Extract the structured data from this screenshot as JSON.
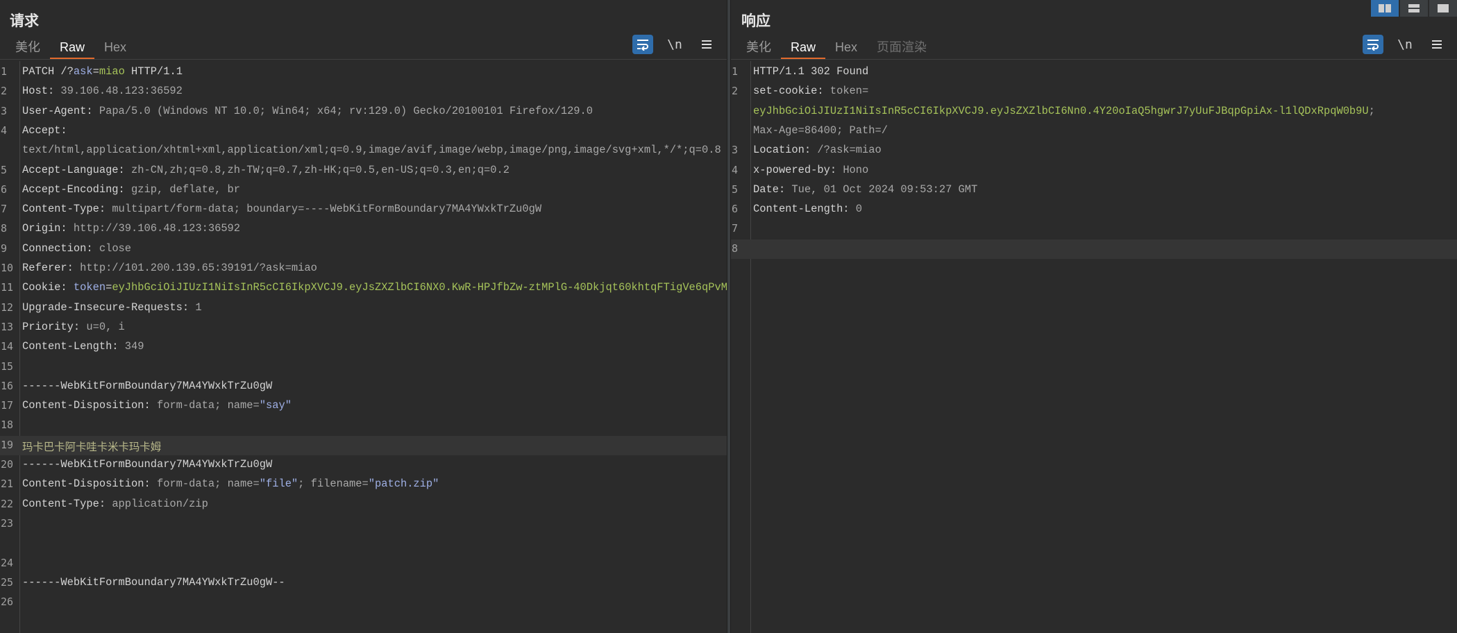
{
  "request": {
    "title": "请求",
    "tabs": [
      {
        "label": "美化",
        "state": "normal"
      },
      {
        "label": "Raw",
        "state": "active"
      },
      {
        "label": "Hex",
        "state": "normal"
      }
    ],
    "tools": {
      "wrap_icon": "wrap-lines-icon",
      "newline_label": "\\n",
      "menu_icon": "menu-icon"
    },
    "lines": [
      {
        "n": "1",
        "parts": [
          [
            "k",
            "PATCH /?"
          ],
          [
            "p",
            "ask"
          ],
          [
            "k",
            "="
          ],
          [
            "s",
            "miao"
          ],
          [
            "k",
            " HTTP/1.1"
          ]
        ]
      },
      {
        "n": "2",
        "parts": [
          [
            "k",
            "Host: "
          ],
          [
            "v",
            "39.106.48.123:36592"
          ]
        ]
      },
      {
        "n": "3",
        "parts": [
          [
            "k",
            "User-Agent: "
          ],
          [
            "v",
            "Papa/5.0 (Windows NT 10.0; Win64; x64; rv:129.0) Gecko/20100101 Firefox/129.0"
          ]
        ]
      },
      {
        "n": "4",
        "parts": [
          [
            "k",
            "Accept: "
          ]
        ]
      },
      {
        "n": "",
        "parts": [
          [
            "v",
            "text/html,application/xhtml+xml,application/xml;q=0.9,image/avif,image/webp,image/png,image/svg+xml,*/*;q=0.8"
          ]
        ]
      },
      {
        "n": "5",
        "parts": [
          [
            "k",
            "Accept-Language: "
          ],
          [
            "v",
            "zh-CN,zh;q=0.8,zh-TW;q=0.7,zh-HK;q=0.5,en-US;q=0.3,en;q=0.2"
          ]
        ]
      },
      {
        "n": "6",
        "parts": [
          [
            "k",
            "Accept-Encoding: "
          ],
          [
            "v",
            "gzip, deflate, br"
          ]
        ]
      },
      {
        "n": "7",
        "parts": [
          [
            "k",
            "Content-Type: "
          ],
          [
            "v",
            "multipart/form-data; boundary=----WebKitFormBoundary7MA4YWxkTrZu0gW"
          ]
        ]
      },
      {
        "n": "8",
        "parts": [
          [
            "k",
            "Origin: "
          ],
          [
            "v",
            "http://39.106.48.123:36592"
          ]
        ]
      },
      {
        "n": "9",
        "parts": [
          [
            "k",
            "Connection: "
          ],
          [
            "v",
            "close"
          ]
        ]
      },
      {
        "n": "10",
        "parts": [
          [
            "k",
            "Referer: "
          ],
          [
            "v",
            "http://101.200.139.65:39191/?ask=miao"
          ]
        ]
      },
      {
        "n": "11",
        "parts": [
          [
            "k",
            "Cookie: "
          ],
          [
            "p",
            "token"
          ],
          [
            "k",
            "="
          ],
          [
            "s",
            "eyJhbGciOiJIUzI1NiIsInR5cCI6IkpXVCJ9.eyJsZXZlbCI6NX0.KwR-HPJfbZw-ztMPlG-40Dkjqt60khtqFTigVe6qPvM"
          ]
        ]
      },
      {
        "n": "12",
        "parts": [
          [
            "k",
            "Upgrade-Insecure-Requests: "
          ],
          [
            "v",
            "1"
          ]
        ]
      },
      {
        "n": "13",
        "parts": [
          [
            "k",
            "Priority: "
          ],
          [
            "v",
            "u=0, i"
          ]
        ]
      },
      {
        "n": "14",
        "parts": [
          [
            "k",
            "Content-Length: "
          ],
          [
            "v",
            "349"
          ]
        ]
      },
      {
        "n": "15",
        "parts": []
      },
      {
        "n": "16",
        "parts": [
          [
            "k",
            "------WebKitFormBoundary7MA4YWxkTrZu0gW"
          ]
        ]
      },
      {
        "n": "17",
        "parts": [
          [
            "k",
            "Content-Disposition: "
          ],
          [
            "v",
            "form-data; name="
          ],
          [
            "p",
            "\"say\""
          ]
        ]
      },
      {
        "n": "18",
        "parts": []
      },
      {
        "n": "19",
        "parts": [
          [
            "cn",
            "玛卡巴卡阿卡哇卡米卡玛卡姆"
          ]
        ],
        "highlight": true
      },
      {
        "n": "20",
        "parts": [
          [
            "k",
            "------WebKitFormBoundary7MA4YWxkTrZu0gW"
          ]
        ]
      },
      {
        "n": "21",
        "parts": [
          [
            "k",
            "Content-Disposition: "
          ],
          [
            "v",
            "form-data; name="
          ],
          [
            "p",
            "\"file\""
          ],
          [
            "v",
            "; filename="
          ],
          [
            "p",
            "\"patch.zip\""
          ]
        ]
      },
      {
        "n": "22",
        "parts": [
          [
            "k",
            "Content-Type: "
          ],
          [
            "v",
            "application/zip"
          ]
        ]
      },
      {
        "n": "23",
        "parts": []
      },
      {
        "n": "",
        "parts": []
      },
      {
        "n": "24",
        "parts": []
      },
      {
        "n": "25",
        "parts": [
          [
            "k",
            "------WebKitFormBoundary7MA4YWxkTrZu0gW--"
          ]
        ]
      },
      {
        "n": "26",
        "parts": []
      }
    ]
  },
  "response": {
    "title": "响应",
    "tabs": [
      {
        "label": "美化",
        "state": "normal"
      },
      {
        "label": "Raw",
        "state": "active"
      },
      {
        "label": "Hex",
        "state": "normal"
      },
      {
        "label": "页面渲染",
        "state": "disabled"
      }
    ],
    "tools": {
      "wrap_icon": "wrap-lines-icon",
      "newline_label": "\\n",
      "menu_icon": "menu-icon"
    },
    "lines": [
      {
        "n": "1",
        "parts": [
          [
            "k",
            "HTTP/1.1 302 Found"
          ]
        ]
      },
      {
        "n": "2",
        "parts": [
          [
            "k",
            "set-cookie: "
          ],
          [
            "v",
            "token="
          ]
        ]
      },
      {
        "n": "",
        "parts": [
          [
            "s",
            "eyJhbGciOiJIUzI1NiIsInR5cCI6IkpXVCJ9.eyJsZXZlbCI6Nn0.4Y20oIaQ5hgwrJ7yUuFJBqpGpiAx-l1lQDxRpqW0b9U"
          ],
          [
            "v",
            ";"
          ]
        ]
      },
      {
        "n": "",
        "parts": [
          [
            "v",
            "Max-Age=86400; Path=/"
          ]
        ]
      },
      {
        "n": "3",
        "parts": [
          [
            "k",
            "Location: "
          ],
          [
            "v",
            "/?ask=miao"
          ]
        ]
      },
      {
        "n": "4",
        "parts": [
          [
            "k",
            "x-powered-by: "
          ],
          [
            "v",
            "Hono"
          ]
        ]
      },
      {
        "n": "5",
        "parts": [
          [
            "k",
            "Date: "
          ],
          [
            "v",
            "Tue, 01 Oct 2024 09:53:27 GMT"
          ]
        ]
      },
      {
        "n": "6",
        "parts": [
          [
            "k",
            "Content-Length: "
          ],
          [
            "v",
            "0"
          ]
        ]
      },
      {
        "n": "7",
        "parts": []
      },
      {
        "n": "8",
        "parts": [],
        "highlight": true
      }
    ]
  },
  "layout_switch": [
    "side-by-side-layout-icon",
    "stacked-layout-icon",
    "single-pane-layout-icon"
  ]
}
